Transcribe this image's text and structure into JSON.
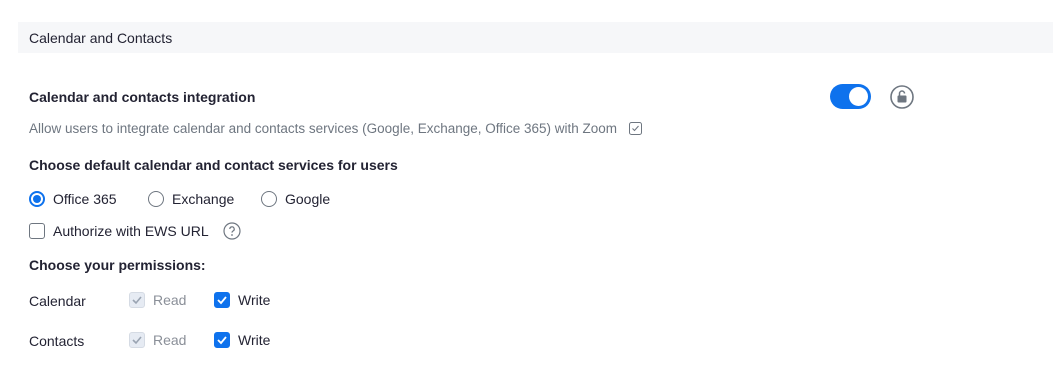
{
  "section": {
    "title": "Calendar and Contacts"
  },
  "setting": {
    "title": "Calendar and contacts integration",
    "enabled": true,
    "description": "Allow users to integrate calendar and contacts services (Google, Exchange, Office 365) with Zoom"
  },
  "services": {
    "heading": "Choose default calendar and contact services for users",
    "options": [
      {
        "label": "Office 365",
        "selected": true
      },
      {
        "label": "Exchange",
        "selected": false
      },
      {
        "label": "Google",
        "selected": false
      }
    ],
    "ews": {
      "label": "Authorize with EWS URL",
      "checked": false
    }
  },
  "permissions": {
    "heading": "Choose your permissions:",
    "rows": [
      {
        "name": "Calendar",
        "read_label": "Read",
        "read_checked": true,
        "read_disabled": true,
        "write_label": "Write",
        "write_checked": true
      },
      {
        "name": "Contacts",
        "read_label": "Read",
        "read_checked": true,
        "read_disabled": true,
        "write_label": "Write",
        "write_checked": true
      }
    ]
  },
  "colors": {
    "accent": "#0e72ed",
    "text": "#232333",
    "muted": "#6e7680",
    "header_bg": "#f6f7f9"
  },
  "icons": {
    "lock": "unlock-icon",
    "info": "info-icon",
    "help": "question-icon"
  }
}
